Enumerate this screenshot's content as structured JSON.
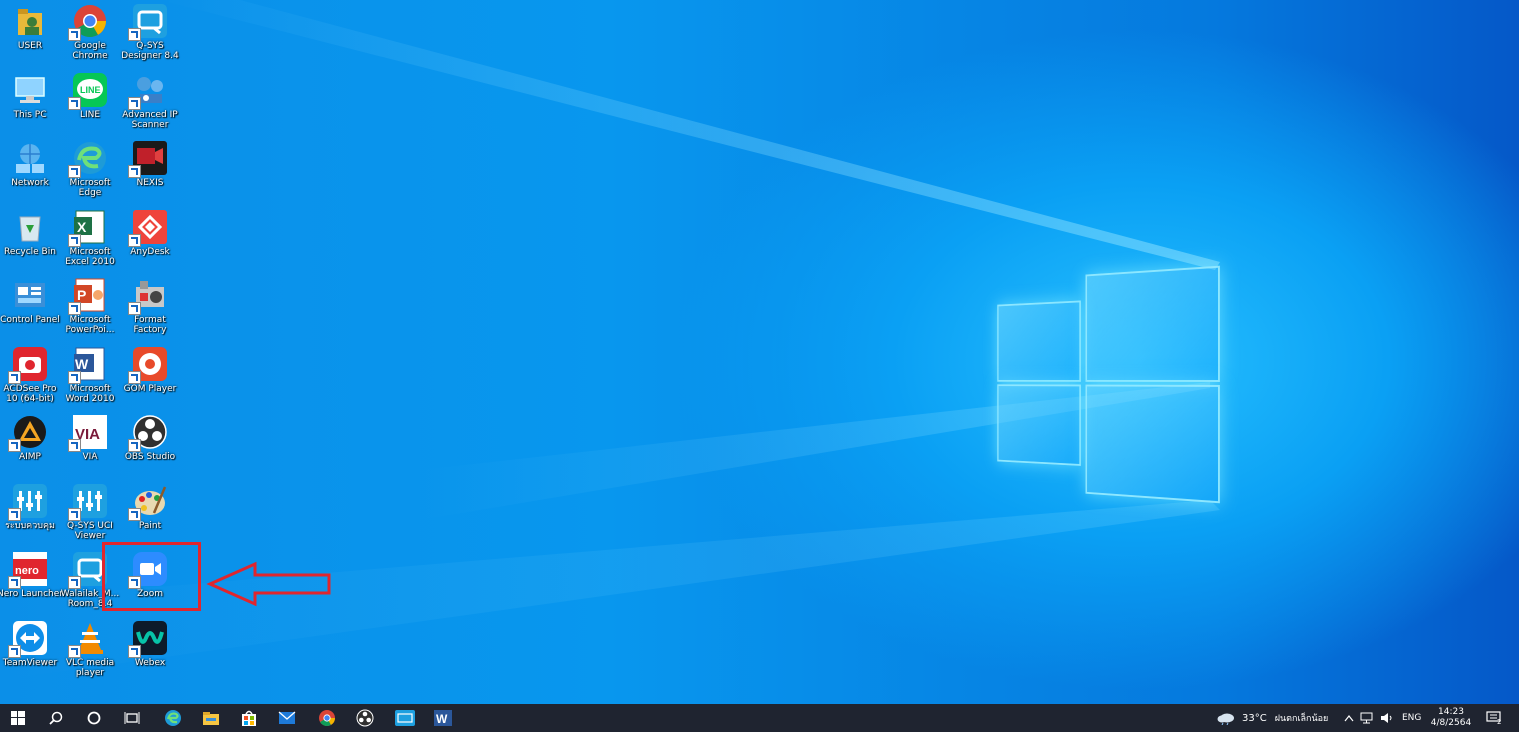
{
  "desktop_icons": [
    {
      "label": "USER",
      "icon": "user-folder-icon",
      "color": "#e8b93a"
    },
    {
      "label": "Google Chrome",
      "icon": "chrome-icon",
      "color": "#4285f4"
    },
    {
      "label": "Q-SYS Designer 8.4",
      "icon": "qsys-designer-icon",
      "color": "#1ea0e0"
    },
    {
      "label": "This PC",
      "icon": "computer-icon",
      "color": "#8fd3ff"
    },
    {
      "label": "LINE",
      "icon": "line-icon",
      "color": "#06c755"
    },
    {
      "label": "Advanced IP Scanner",
      "icon": "ip-scanner-icon",
      "color": "#4a9fe0"
    },
    {
      "label": "Network",
      "icon": "network-icon",
      "color": "#5ab4f0"
    },
    {
      "label": "Microsoft Edge",
      "icon": "edge-icon",
      "color": "#1e9bd7"
    },
    {
      "label": "NEXIS",
      "icon": "nexis-icon",
      "color": "#c0202a"
    },
    {
      "label": "Recycle Bin",
      "icon": "recycle-bin-icon",
      "color": "#d8e8f0"
    },
    {
      "label": "Microsoft Excel 2010",
      "icon": "excel-icon",
      "color": "#1e7145"
    },
    {
      "label": "AnyDesk",
      "icon": "anydesk-icon",
      "color": "#ef443b"
    },
    {
      "label": "Control Panel",
      "icon": "control-panel-icon",
      "color": "#3a8fd8"
    },
    {
      "label": "Microsoft PowerPoi...",
      "icon": "powerpoint-icon",
      "color": "#d24726"
    },
    {
      "label": "Format Factory",
      "icon": "format-factory-icon",
      "color": "#c8c8c8"
    },
    {
      "label": "ACDSee Pro 10 (64-bit)",
      "icon": "acdsee-icon",
      "color": "#e0262e"
    },
    {
      "label": "Microsoft Word 2010",
      "icon": "word-icon",
      "color": "#2b579a"
    },
    {
      "label": "GOM Player",
      "icon": "gom-player-icon",
      "color": "#e84a2a"
    },
    {
      "label": "AIMP",
      "icon": "aimp-icon",
      "color": "#f5a623"
    },
    {
      "label": "VIA",
      "icon": "via-icon",
      "color": "#ffffff"
    },
    {
      "label": "OBS Studio",
      "icon": "obs-icon",
      "color": "#202020"
    },
    {
      "label": "ระบบควบคุม",
      "icon": "control-system-icon",
      "color": "#1ea0e0"
    },
    {
      "label": "Q-SYS UCI Viewer",
      "icon": "uci-viewer-icon",
      "color": "#1ea0e0"
    },
    {
      "label": "Paint",
      "icon": "paint-icon",
      "color": "#e8d9b0"
    },
    {
      "label": "Nero Launcher",
      "icon": "nero-icon",
      "color": "#e0262e"
    },
    {
      "label": "Walailak_M... Room_8.4",
      "icon": "walailak-room-icon",
      "color": "#1ea0e0"
    },
    {
      "label": "Zoom",
      "icon": "zoom-icon",
      "color": "#2d8cff"
    },
    {
      "label": "TeamViewer",
      "icon": "teamviewer-icon",
      "color": "#0e8ee9"
    },
    {
      "label": "VLC media player",
      "icon": "vlc-icon",
      "color": "#f28a00"
    },
    {
      "label": "Webex",
      "icon": "webex-icon",
      "color": "#07c4a8"
    }
  ],
  "annotation": {
    "box_color": "#e0262e",
    "arrow_color": "#e0262e"
  },
  "taskbar": {
    "buttons": [
      "start-button",
      "search-button",
      "cortana-button",
      "task-view-button",
      "edge-taskbar",
      "file-explorer-taskbar",
      "store-taskbar",
      "mail-taskbar",
      "chrome-taskbar",
      "obs-taskbar",
      "qsys-taskbar",
      "word-taskbar"
    ],
    "weather_temp": "33°C",
    "weather_text": "ฝนตกเล็กน้อย",
    "language": "ENG",
    "time": "14:23",
    "date": "4/8/2564",
    "notification_count": "2"
  }
}
